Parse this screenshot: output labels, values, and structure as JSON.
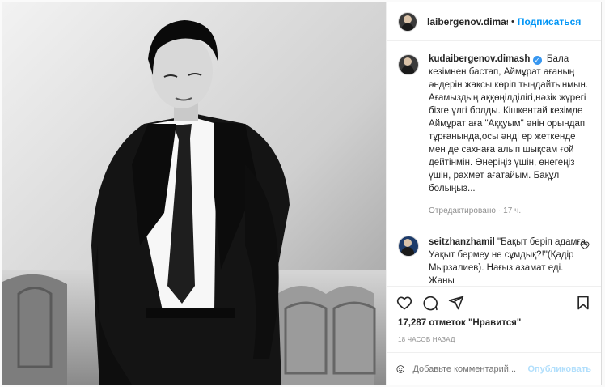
{
  "post": {
    "author": "kudaibergenov.dimash",
    "header_username": "laibergenov.dimasl",
    "follow_label": "Подписаться",
    "caption": "Бала кезімнен бастап, Аймұрат ағаның әндерін жақсы көріп тыңдайтынмын. Ағамыздың аққөңілділігі,нәзік жүрегі бізге үлгі болды. Кішкентай кезімде Аймұрат аға \"Аққуым\" әнін орындап тұрғанында,осы әнді ер жеткенде мен де сахнаға алып шықсам ғой дейтінмін. Өнеріңіз үшін, өнегеңіз үшін, рахмет ағатайым. Бақұл болыңыз...",
    "edited_label": "Отредактировано",
    "edited_time": "17 ч.",
    "likes": "17,287 отметок \"Нравится\"",
    "posted_time": "18 ЧАСОВ НАЗАД"
  },
  "comment": {
    "username": "seitzhanzhamil",
    "text": "\"Бақыт беріп адамға, Уақыт бермеу не сұмдық?!\"(Қадір Мырзалиев). Нағыз азамат еді. Жаны"
  },
  "add_comment": {
    "placeholder": "Добавьте комментарий...",
    "publish_label": "Опубликовать"
  },
  "icons": {
    "like": "heart-icon",
    "comment": "comment-icon",
    "share": "share-icon",
    "save": "bookmark-icon",
    "emoji": "emoji-icon",
    "verified": "verified-badge-icon"
  }
}
